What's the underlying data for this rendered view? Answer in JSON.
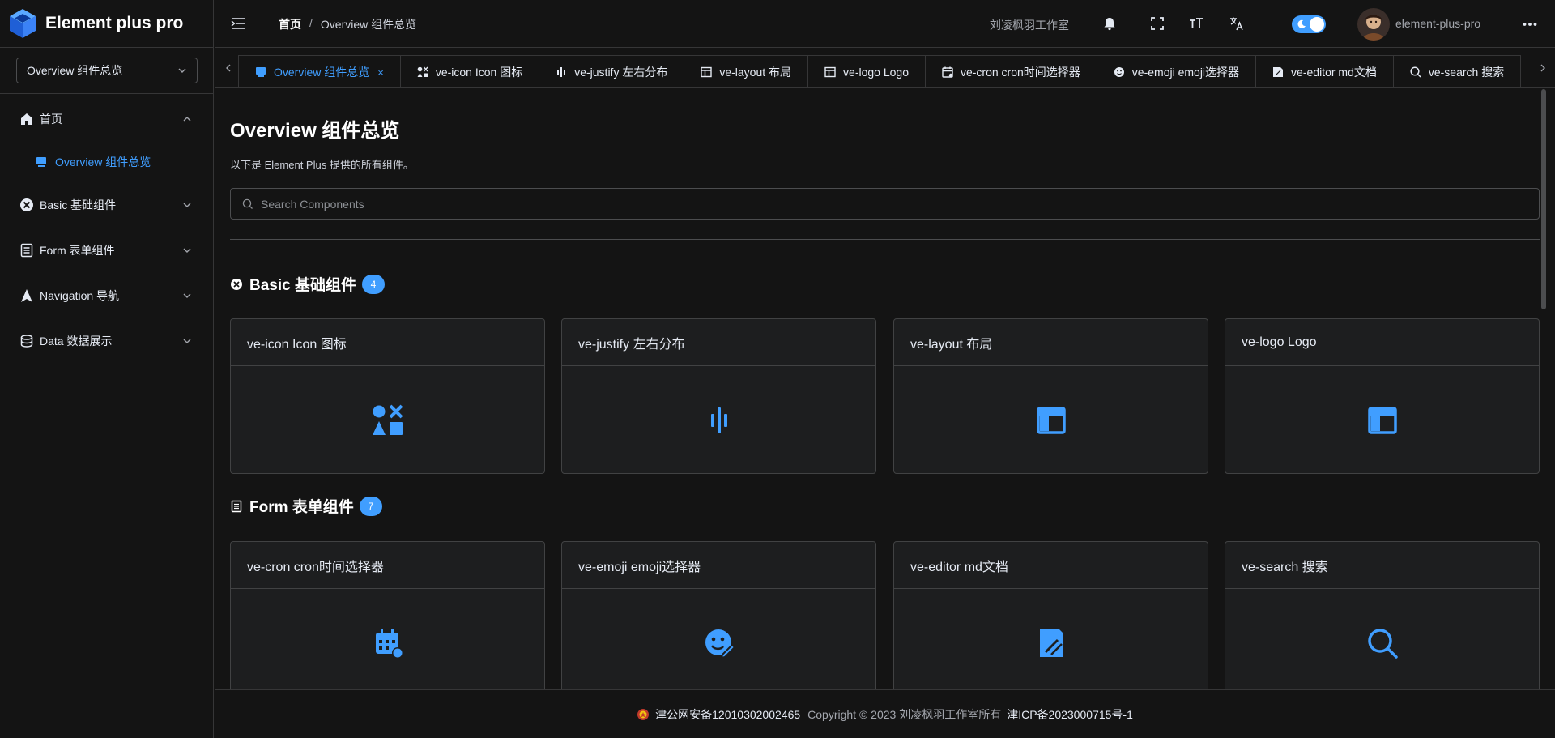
{
  "app": {
    "title": "Element plus pro"
  },
  "sidebar": {
    "switcher_value": "Overview 组件总览",
    "menu": [
      {
        "label": "首页",
        "icon": "home-icon",
        "expanded": true
      },
      {
        "label": "Overview 组件总览",
        "icon": "monitor-icon",
        "active": true
      },
      {
        "label": "Basic 基础组件",
        "icon": "circle-close-icon"
      },
      {
        "label": "Form 表单组件",
        "icon": "document-icon"
      },
      {
        "label": "Navigation 导航",
        "icon": "navigation-icon"
      },
      {
        "label": "Data 数据展示",
        "icon": "coin-icon"
      }
    ]
  },
  "header": {
    "breadcrumb": {
      "home": "首页",
      "separator": "/",
      "current": "Overview 组件总览"
    },
    "studio": "刘凌枫羽工作室",
    "dark_mode": true,
    "username": "element-plus-pro"
  },
  "tabs": [
    {
      "label": "Overview 组件总览",
      "icon": "monitor-icon",
      "active": true,
      "close": "×"
    },
    {
      "label": "ve-icon Icon 图标",
      "icon": "shapes-icon"
    },
    {
      "label": "ve-justify 左右分布",
      "icon": "justify-icon"
    },
    {
      "label": "ve-layout 布局",
      "icon": "layout-icon"
    },
    {
      "label": "ve-logo Logo",
      "icon": "layout-icon"
    },
    {
      "label": "ve-cron cron时间选择器",
      "icon": "calendar-icon"
    },
    {
      "label": "ve-emoji emoji选择器",
      "icon": "emoji-icon"
    },
    {
      "label": "ve-editor md文档",
      "icon": "edit-icon"
    },
    {
      "label": "ve-search 搜索",
      "icon": "search-icon"
    }
  ],
  "main": {
    "title": "Overview 组件总览",
    "description": "以下是 Element Plus 提供的所有组件。",
    "search_placeholder": "Search Components",
    "sections": [
      {
        "title": "Basic 基础组件",
        "icon": "circle-close-icon",
        "count": "4",
        "cards": [
          {
            "label": "ve-icon Icon 图标",
            "icon": "shapes-icon"
          },
          {
            "label": "ve-justify 左右分布",
            "icon": "justify-icon"
          },
          {
            "label": "ve-layout 布局",
            "icon": "layout-icon"
          },
          {
            "label": "ve-logo Logo",
            "icon": "layout-icon"
          }
        ]
      },
      {
        "title": "Form 表单组件",
        "icon": "document-icon",
        "count": "7",
        "cards": [
          {
            "label": "ve-cron cron时间选择器",
            "icon": "calendar-icon"
          },
          {
            "label": "ve-emoji emoji选择器",
            "icon": "emoji-icon"
          },
          {
            "label": "ve-editor md文档",
            "icon": "edit-icon"
          },
          {
            "label": "ve-search 搜索",
            "icon": "search-icon"
          }
        ]
      }
    ]
  },
  "footer": {
    "police": "津公网安备12010302002465",
    "copyright": "Copyright © 2023 刘凌枫羽工作室所有",
    "icp": "津ICP备2023000715号-1"
  },
  "colors": {
    "accent": "#409eff",
    "background": "#141414",
    "card": "#1d1e1f",
    "border": "#414243"
  }
}
